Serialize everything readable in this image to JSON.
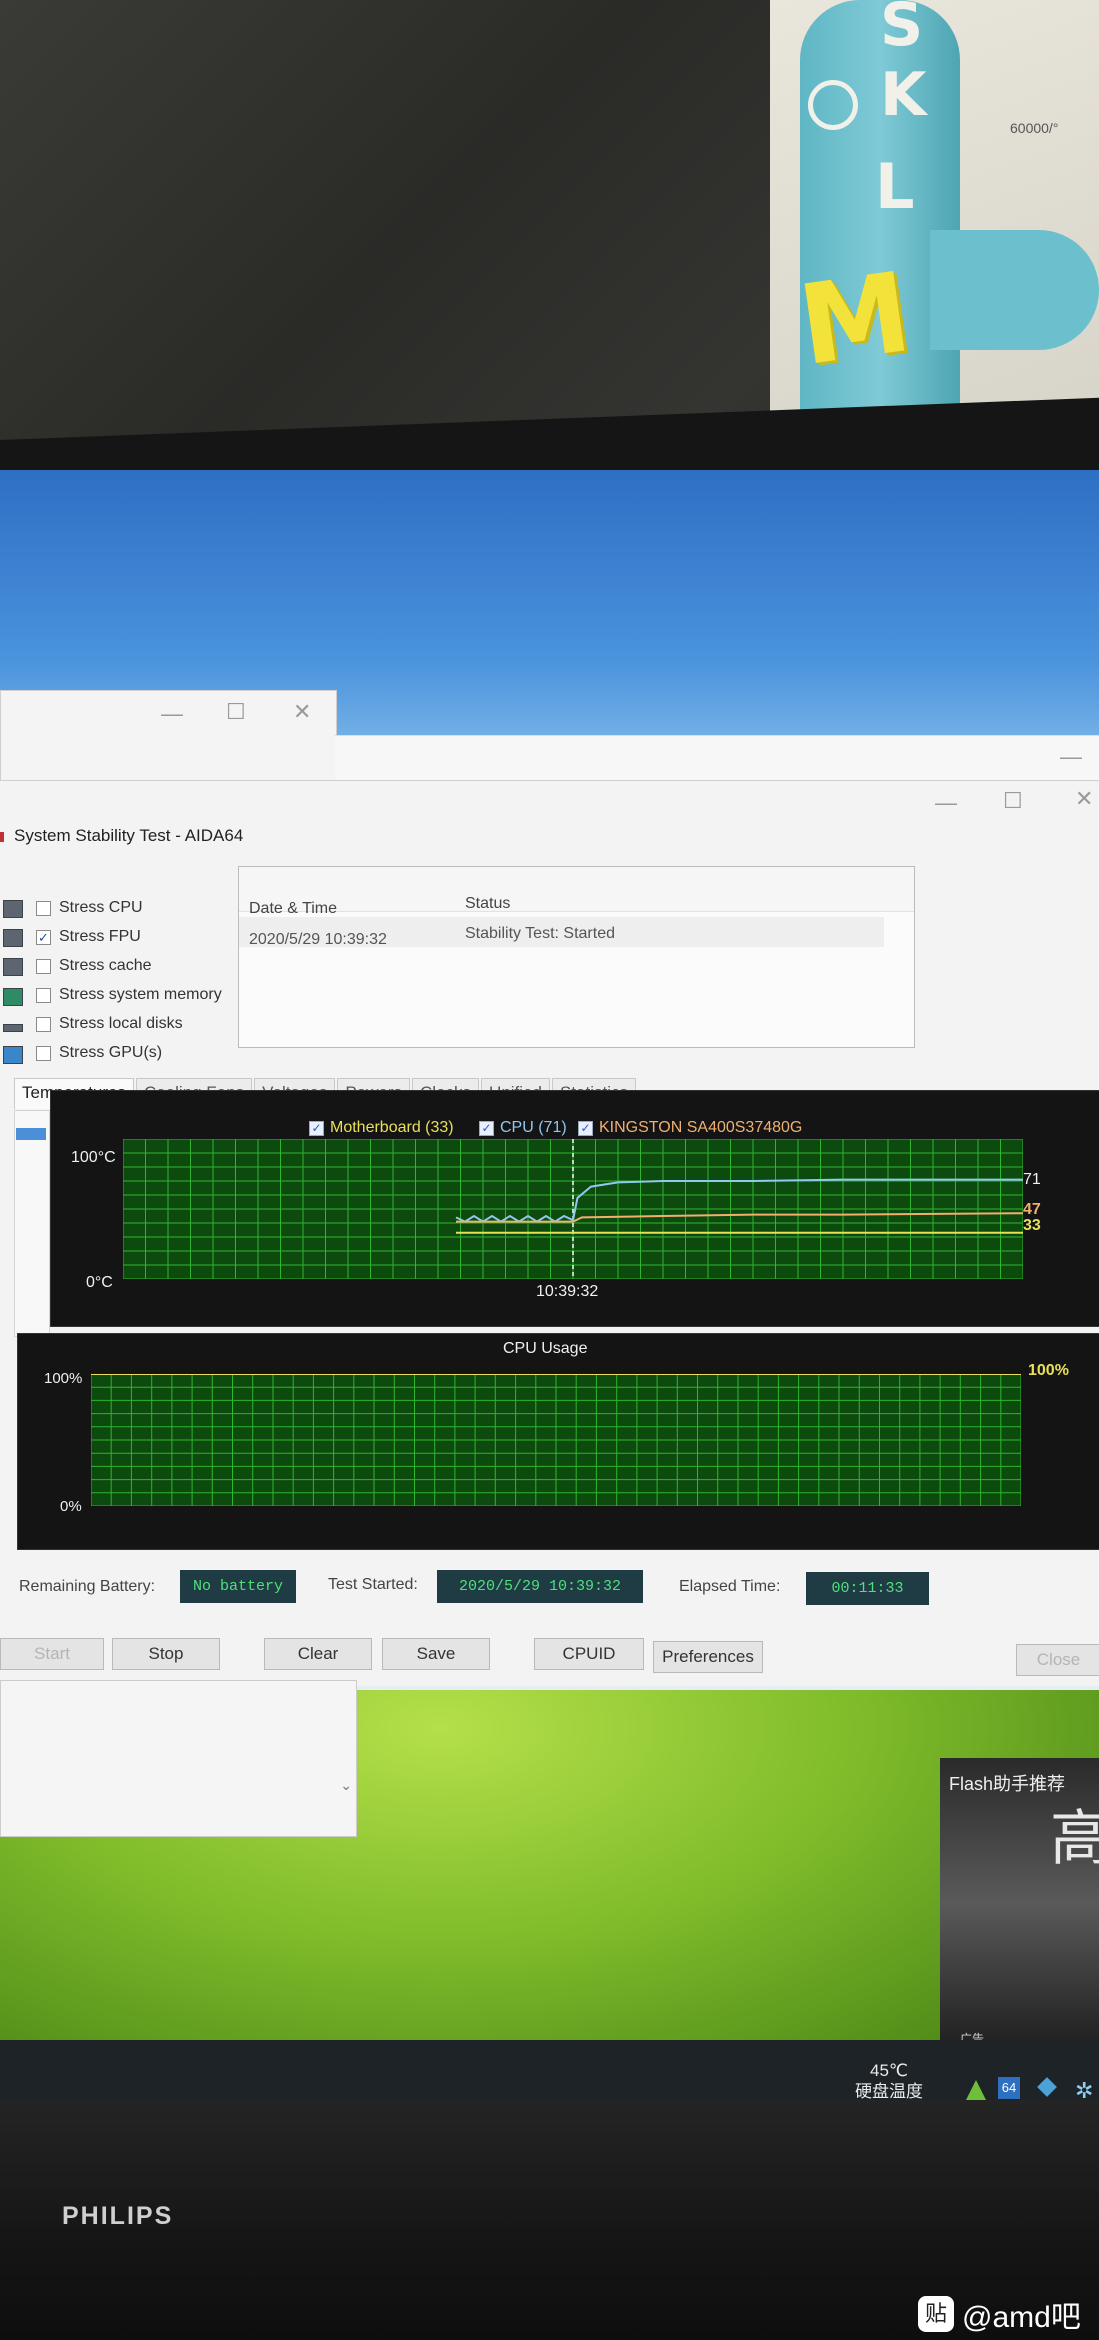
{
  "scene": {
    "toy_letters": [
      "S",
      "K",
      "L",
      "M"
    ],
    "toy_sticker": "60000/°",
    "monitor_brand": "PHILIPS",
    "watermark": "@amd吧",
    "watermark_badge": "贴"
  },
  "window": {
    "title": "System Stability Test - AIDA64",
    "minimize": "—",
    "maximize": "☐",
    "close": "✕"
  },
  "stress_options": [
    {
      "label": "Stress CPU",
      "checked": false,
      "icon": "cpu-icon"
    },
    {
      "label": "Stress FPU",
      "checked": true,
      "icon": "fpu-icon"
    },
    {
      "label": "Stress cache",
      "checked": false,
      "icon": "cache-icon"
    },
    {
      "label": "Stress system memory",
      "checked": false,
      "icon": "memory-icon"
    },
    {
      "label": "Stress local disks",
      "checked": false,
      "icon": "disk-icon"
    },
    {
      "label": "Stress GPU(s)",
      "checked": false,
      "icon": "monitor-icon"
    }
  ],
  "status_table": {
    "headers": [
      "Date & Time",
      "Status"
    ],
    "rows": [
      [
        "2020/5/29 10:39:32",
        "Stability Test: Started"
      ]
    ]
  },
  "tabs": [
    "Temperatures",
    "Cooling Fans",
    "Voltages",
    "Powers",
    "Clocks",
    "Unified",
    "Statistics"
  ],
  "chart_data": [
    {
      "type": "line",
      "name": "temperatures",
      "ylim": [
        0,
        100
      ],
      "ytick_labels": [
        "100°C",
        "0°C"
      ],
      "xtick_labels": [
        "10:39:32"
      ],
      "marker_x_fraction": 0.5,
      "series": [
        {
          "name": "Motherboard (33)",
          "color": "#e8e05a",
          "end_label": "33",
          "points": [
            [
              0.37,
              33
            ],
            [
              0.5,
              33
            ],
            [
              0.6,
              33
            ],
            [
              0.8,
              33
            ],
            [
              1.0,
              33
            ]
          ]
        },
        {
          "name": "CPU (71)",
          "color": "#8fc8f0",
          "end_label": "71",
          "points": [
            [
              0.37,
              44
            ],
            [
              0.38,
              41
            ],
            [
              0.39,
              45
            ],
            [
              0.4,
              41
            ],
            [
              0.41,
              45
            ],
            [
              0.42,
              41
            ],
            [
              0.43,
              45
            ],
            [
              0.44,
              41
            ],
            [
              0.45,
              45
            ],
            [
              0.46,
              41
            ],
            [
              0.47,
              45
            ],
            [
              0.48,
              41
            ],
            [
              0.49,
              45
            ],
            [
              0.5,
              42
            ],
            [
              0.505,
              58
            ],
            [
              0.52,
              66
            ],
            [
              0.55,
              69
            ],
            [
              0.6,
              70
            ],
            [
              0.7,
              70
            ],
            [
              0.8,
              71
            ],
            [
              1.0,
              71
            ]
          ]
        },
        {
          "name": "KINGSTON SA400S37480G",
          "color": "#f0b070",
          "end_label": "47",
          "points": [
            [
              0.37,
              41
            ],
            [
              0.5,
              41
            ],
            [
              0.51,
              44
            ],
            [
              0.6,
              45
            ],
            [
              0.7,
              46
            ],
            [
              0.8,
              46
            ],
            [
              1.0,
              47
            ]
          ]
        }
      ]
    },
    {
      "type": "line",
      "name": "cpu_usage",
      "title": "CPU Usage",
      "ylim": [
        0,
        100
      ],
      "ytick_labels": [
        "100%",
        "0%"
      ],
      "series": [
        {
          "color": "#e8e05a",
          "end_label": "100%",
          "points": [
            [
              0,
              100
            ],
            [
              1,
              100
            ]
          ]
        }
      ]
    }
  ],
  "fields": {
    "remaining_battery_label": "Remaining Battery:",
    "remaining_battery": "No battery",
    "test_started_label": "Test Started:",
    "test_started": "2020/5/29 10:39:32",
    "elapsed_label": "Elapsed Time:",
    "elapsed": "00:11:33"
  },
  "buttons": {
    "start": "Start",
    "stop": "Stop",
    "clear": "Clear",
    "save": "Save",
    "cpuid": "CPUID",
    "preferences": "Preferences",
    "close": "Close"
  },
  "taskbar": {
    "temp_value": "45℃",
    "temp_label": "硬盘温度",
    "tray_badge": "64"
  },
  "ad": {
    "title": "Flash助手推荐",
    "char": "高",
    "footer": "广告"
  },
  "colors": {
    "grid_bg": "#0d4a0d",
    "grid_line": "#2fb52f",
    "panel_bg": "#141414",
    "field_bg": "#1f3b44",
    "field_text": "#4fe07a"
  }
}
